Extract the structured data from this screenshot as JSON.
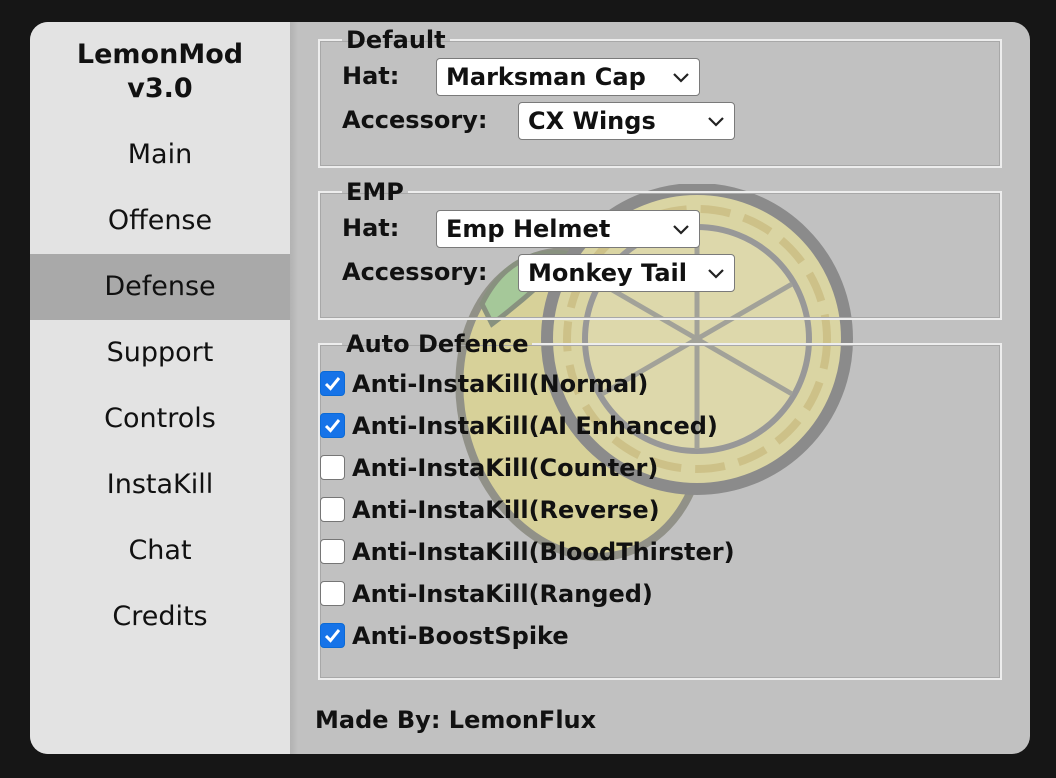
{
  "app": {
    "title_line1": "LemonMod",
    "title_line2": "v3.0"
  },
  "sidebar": {
    "items": [
      {
        "label": "Main",
        "active": false
      },
      {
        "label": "Offense",
        "active": false
      },
      {
        "label": "Defense",
        "active": true
      },
      {
        "label": "Support",
        "active": false
      },
      {
        "label": "Controls",
        "active": false
      },
      {
        "label": "InstaKill",
        "active": false
      },
      {
        "label": "Chat",
        "active": false
      },
      {
        "label": "Credits",
        "active": false
      }
    ]
  },
  "default_section": {
    "legend": "Default",
    "hat_label": "Hat:",
    "hat_value": "Marksman Cap",
    "accessory_label": "Accessory:",
    "accessory_value": "CX Wings"
  },
  "emp_section": {
    "legend": "EMP",
    "hat_label": "Hat:",
    "hat_value": "Emp Helmet",
    "accessory_label": "Accessory:",
    "accessory_value": "Monkey Tail"
  },
  "auto_defence": {
    "legend": "Auto Defence",
    "options": [
      {
        "label": "Anti-InstaKill(Normal)",
        "checked": true
      },
      {
        "label": "Anti-InstaKill(AI Enhanced)",
        "checked": true
      },
      {
        "label": "Anti-InstaKill(Counter)",
        "checked": false
      },
      {
        "label": "Anti-InstaKill(Reverse)",
        "checked": false
      },
      {
        "label": "Anti-InstaKill(BloodThirster)",
        "checked": false
      },
      {
        "label": "Anti-InstaKill(Ranged)",
        "checked": false
      },
      {
        "label": "Anti-BoostSpike",
        "checked": true
      }
    ]
  },
  "footer": {
    "text": "Made By: LemonFlux"
  },
  "colors": {
    "checkbox_accent": "#1673e8",
    "sidebar_bg": "#e3e3e3",
    "sidebar_active_bg": "#a9a9a9",
    "content_bg": "#c1c1c1"
  },
  "icons": {
    "watermark": "lemon-logo-icon",
    "dropdown": "chevron-down-icon",
    "check": "checkmark-icon"
  }
}
